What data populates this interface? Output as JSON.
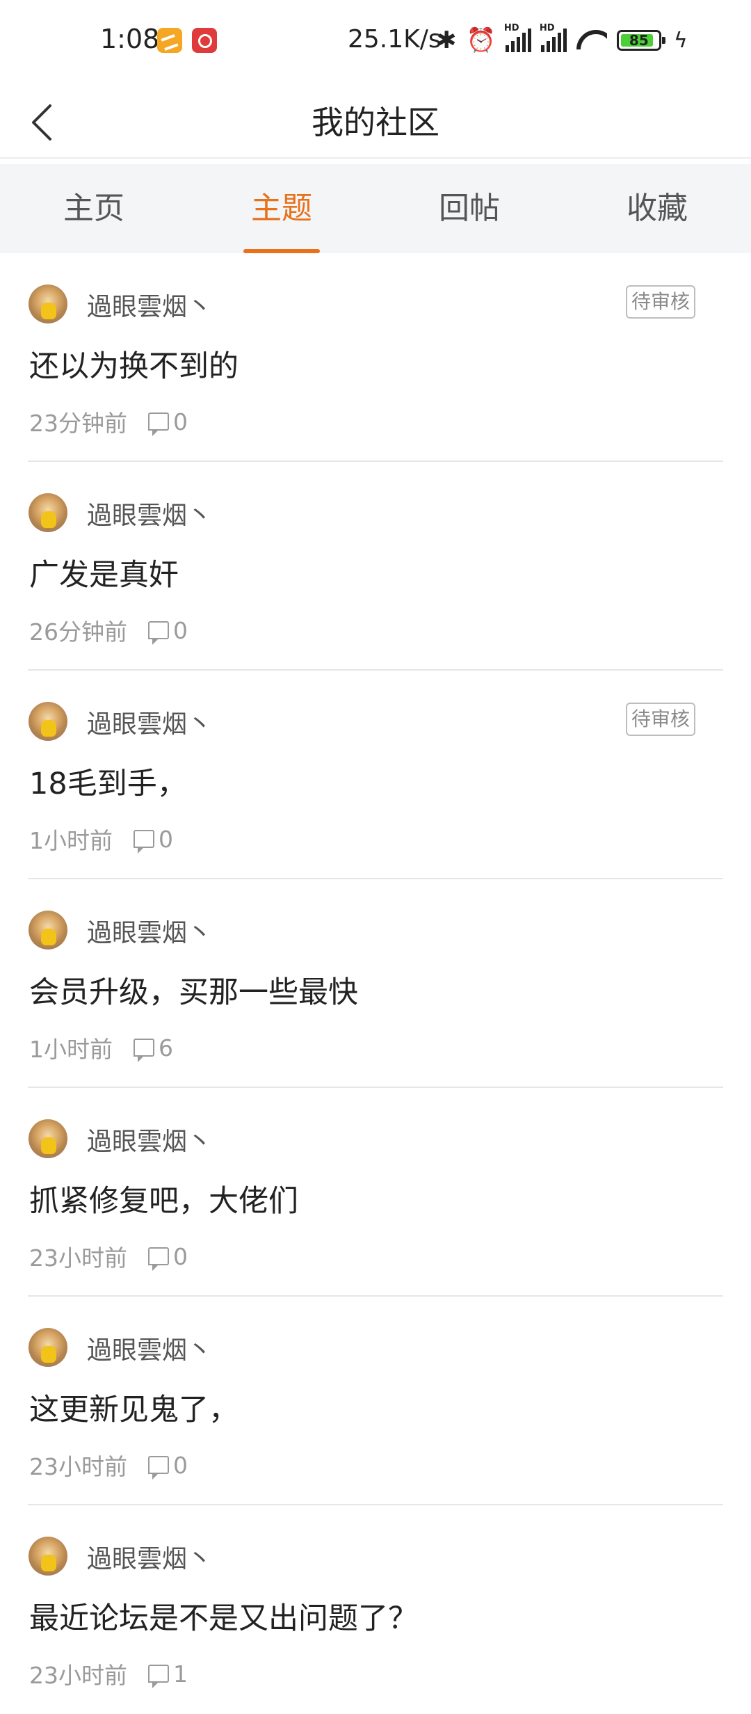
{
  "status_bar": {
    "time": "1:08",
    "net_speed": "25.1K/s",
    "battery": "85",
    "icons": [
      "app-badge-icon",
      "netease-music-icon",
      "bluetooth-icon",
      "alarm-icon",
      "signal-hd-icon",
      "signal-hd-icon",
      "wifi-icon",
      "battery-icon",
      "charging-icon"
    ]
  },
  "header": {
    "title": "我的社区",
    "back_icon": "chevron-left-icon"
  },
  "tabs": [
    {
      "label": "主页",
      "active": false
    },
    {
      "label": "主题",
      "active": true
    },
    {
      "label": "回帖",
      "active": false
    },
    {
      "label": "收藏",
      "active": false
    }
  ],
  "colors": {
    "accent": "#e8711c",
    "tab_bg": "#f4f5f7",
    "meta_text": "#9a9a9a"
  },
  "posts": [
    {
      "user": "過眼雲烟丶",
      "title": "还以为换不到的",
      "time": "23分钟前",
      "comments": "0",
      "badge": "待审核"
    },
    {
      "user": "過眼雲烟丶",
      "title": "广发是真奸",
      "time": "26分钟前",
      "comments": "0",
      "badge": ""
    },
    {
      "user": "過眼雲烟丶",
      "title": "18毛到手，",
      "time": "1小时前",
      "comments": "0",
      "badge": "待审核"
    },
    {
      "user": "過眼雲烟丶",
      "title": "会员升级，买那一些最快",
      "time": "1小时前",
      "comments": "6",
      "badge": ""
    },
    {
      "user": "過眼雲烟丶",
      "title": "抓紧修复吧，大佬们",
      "time": "23小时前",
      "comments": "0",
      "badge": ""
    },
    {
      "user": "過眼雲烟丶",
      "title": "这更新见鬼了，",
      "time": "23小时前",
      "comments": "0",
      "badge": ""
    },
    {
      "user": "過眼雲烟丶",
      "title": "最近论坛是不是又出问题了？",
      "time": "23小时前",
      "comments": "1",
      "badge": ""
    }
  ]
}
